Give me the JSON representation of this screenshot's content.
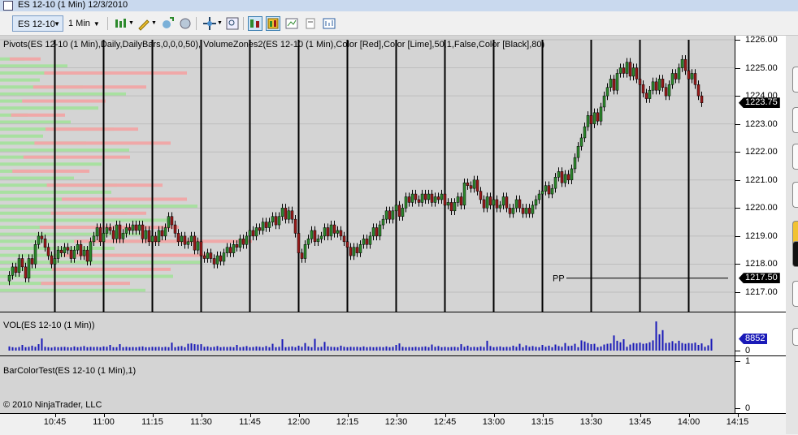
{
  "window": {
    "title": "ES 12-10 (1 Min)  12/3/2010"
  },
  "toolbar": {
    "instrument": "ES 12-10",
    "timeframe": "1 Min",
    "icons": [
      "bars-chart-icon",
      "pencil-draw-icon",
      "add-indicator-icon",
      "strategies-icon",
      "crosshair-icon",
      "zoom-icon",
      "chart-trader-icon",
      "data-box-icon",
      "chart-properties-icon",
      "copy-icon",
      "chart-style-icon"
    ]
  },
  "panels": {
    "price": {
      "label": "Pivots(ES 12-10 (1 Min),Daily,DailyBars,0,0,0,50), VolumeZones2(ES 12-10 (1 Min),Color [Red],Color [Lime],50,1,False,Color [Black],80)"
    },
    "volume": {
      "label": "VOL(ES 12-10 (1 Min))"
    },
    "barcolor": {
      "label": "BarColorTest(ES 12-10 (1 Min),1)"
    }
  },
  "copyright": "© 2010 NinjaTrader, LLC",
  "pivot": {
    "label": "PP",
    "value": "1217.50",
    "price": 1217.5
  },
  "last_price": {
    "value": "1223.75",
    "price": 1223.75
  },
  "last_volume": {
    "value": "8852"
  },
  "y_labels": [
    "1226.00",
    "1225.00",
    "1224.00",
    "1223.00",
    "1222.00",
    "1221.00",
    "1220.00",
    "1219.00",
    "1218.00",
    "1217.00"
  ],
  "vol_labels": [
    "0"
  ],
  "barcolor_labels": [
    "1",
    "0"
  ],
  "x_labels": [
    "10:45",
    "11:00",
    "11:15",
    "11:30",
    "11:45",
    "12:00",
    "12:15",
    "12:30",
    "12:45",
    "13:00",
    "13:15",
    "13:30",
    "13:45",
    "14:00",
    "14:15"
  ],
  "colors": {
    "up": "#2d8a2d",
    "down": "#9b1a1a",
    "volume": "#1a1ab8",
    "zone_buy": "#a8e0a0",
    "zone_sell": "#f0a8a8",
    "background": "#d4d4d4"
  },
  "chart_data": {
    "type": "candlestick",
    "x_start": "10:31",
    "interval_minutes": 1,
    "ylim": [
      1216.7,
      1226.1
    ],
    "closes": [
      1217.6,
      1217.9,
      1217.7,
      1218.2,
      1217.9,
      1217.5,
      1218.2,
      1218.0,
      1218.7,
      1219.0,
      1218.9,
      1218.6,
      1218.3,
      1218.0,
      1218.2,
      1218.5,
      1218.4,
      1218.6,
      1218.5,
      1218.2,
      1218.5,
      1218.7,
      1218.3,
      1218.5,
      1218.1,
      1218.8,
      1219.0,
      1219.3,
      1218.8,
      1219.1,
      1219.3,
      1219.2,
      1218.9,
      1219.4,
      1218.9,
      1219.1,
      1219.3,
      1219.2,
      1219.4,
      1219.2,
      1219.4,
      1218.9,
      1219.2,
      1218.8,
      1219.0,
      1218.8,
      1219.2,
      1219.0,
      1219.3,
      1219.7,
      1219.4,
      1219.1,
      1218.8,
      1219.0,
      1218.7,
      1218.8,
      1219.0,
      1218.5,
      1218.8,
      1218.3,
      1218.2,
      1218.4,
      1218.2,
      1218.0,
      1218.3,
      1218.1,
      1218.4,
      1218.6,
      1218.4,
      1218.7,
      1218.6,
      1218.9,
      1218.7,
      1219.0,
      1219.2,
      1219.0,
      1219.3,
      1219.2,
      1219.5,
      1219.3,
      1219.5,
      1219.7,
      1219.4,
      1219.7,
      1220.0,
      1219.6,
      1219.9,
      1219.6,
      1219.1,
      1218.4,
      1218.2,
      1218.7,
      1218.9,
      1219.2,
      1218.8,
      1218.9,
      1219.0,
      1219.3,
      1219.0,
      1219.4,
      1219.1,
      1219.2,
      1219.0,
      1218.8,
      1218.6,
      1218.3,
      1218.6,
      1218.4,
      1218.7,
      1218.9,
      1218.7,
      1219.0,
      1219.3,
      1219.0,
      1219.4,
      1219.6,
      1219.9,
      1219.6,
      1219.9,
      1220.1,
      1219.7,
      1220.0,
      1220.4,
      1220.2,
      1220.5,
      1220.3,
      1220.2,
      1220.5,
      1220.3,
      1220.5,
      1220.2,
      1220.4,
      1220.3,
      1220.5,
      1220.1,
      1220.2,
      1219.9,
      1220.2,
      1220.4,
      1220.1,
      1220.9,
      1220.8,
      1220.7,
      1221.0,
      1220.6,
      1220.3,
      1220.0,
      1220.4,
      1220.1,
      1220.3,
      1220.0,
      1220.1,
      1220.4,
      1220.0,
      1219.8,
      1220.0,
      1220.3,
      1220.0,
      1219.8,
      1220.0,
      1219.8,
      1220.1,
      1220.3,
      1220.5,
      1220.6,
      1220.8,
      1220.5,
      1220.7,
      1221.1,
      1221.3,
      1220.9,
      1221.2,
      1221.0,
      1221.4,
      1221.8,
      1222.2,
      1222.5,
      1222.9,
      1223.3,
      1223.0,
      1223.4,
      1223.1,
      1223.6,
      1224.0,
      1224.3,
      1224.6,
      1224.2,
      1224.8,
      1225.0,
      1224.8,
      1225.2,
      1224.7,
      1225.0,
      1224.6,
      1224.4,
      1224.1,
      1223.9,
      1224.2,
      1224.5,
      1224.2,
      1224.6,
      1224.3,
      1224.0,
      1224.4,
      1224.8,
      1224.6,
      1225.0,
      1225.3,
      1224.9,
      1224.6,
      1224.8,
      1224.4,
      1224.0,
      1223.75
    ],
    "volume_scale_max": 9000,
    "volumes": [
      1100,
      900,
      800,
      950,
      1500,
      900,
      1000,
      1300,
      1000,
      1700,
      3200,
      1000,
      900,
      800,
      1000,
      900,
      950,
      1000,
      900,
      850,
      1100,
      900,
      1000,
      1200,
      900,
      1000,
      950,
      1000,
      900,
      1100,
      1000,
      1500,
      900,
      900,
      1700,
      900,
      1000,
      900,
      950,
      900,
      1000,
      1100,
      900,
      900,
      1000,
      950,
      1000,
      900,
      1000,
      900,
      2100,
      900,
      1100,
      1200,
      900,
      1800,
      1900,
      1700,
      1600,
      1700,
      1000,
      1100,
      900,
      1000,
      1200,
      900,
      1000,
      950,
      1000,
      900,
      1500,
      900,
      1000,
      1200,
      900,
      950,
      1100,
      1000,
      900,
      1200,
      900,
      1800,
      900,
      1000,
      3000,
      900,
      1000,
      1100,
      900,
      1300,
      1000,
      2000,
      1100,
      900,
      3100,
      900,
      1000,
      2300,
      1100,
      1000,
      950,
      900,
      1300,
      1000,
      900,
      1000,
      950,
      1000,
      900,
      1100,
      900,
      1000,
      900,
      950,
      1000,
      900,
      1100,
      900,
      1000,
      1500,
      1900,
      1000,
      900,
      950,
      900,
      1000,
      900,
      1000,
      1100,
      900,
      1600,
      1000,
      1200,
      900,
      1000,
      900,
      950,
      1000,
      900,
      1700,
      1000,
      1300,
      900,
      1000,
      900,
      1100,
      950,
      2600,
      1200,
      900,
      1000,
      1100,
      900,
      1000,
      950,
      1300,
      1000,
      1800,
      900,
      1400,
      1000,
      1200,
      1000,
      900,
      1500,
      1000,
      1300,
      900,
      1600,
      1200,
      1000,
      2000,
      1200,
      1300,
      1800,
      900,
      2700,
      2400,
      2000,
      1700,
      1800,
      900,
      1100,
      1600,
      1800,
      1900,
      4000,
      2600,
      2200,
      3000,
      1000,
      1600,
      2000,
      1900,
      2100,
      1800,
      1900,
      2200,
      2700,
      7700,
      4300,
      5400,
      2000,
      2100,
      2500,
      1900,
      2600,
      2000,
      1800,
      2000,
      1900,
      2100,
      1500,
      1900,
      1000,
      1400,
      3100
    ]
  }
}
